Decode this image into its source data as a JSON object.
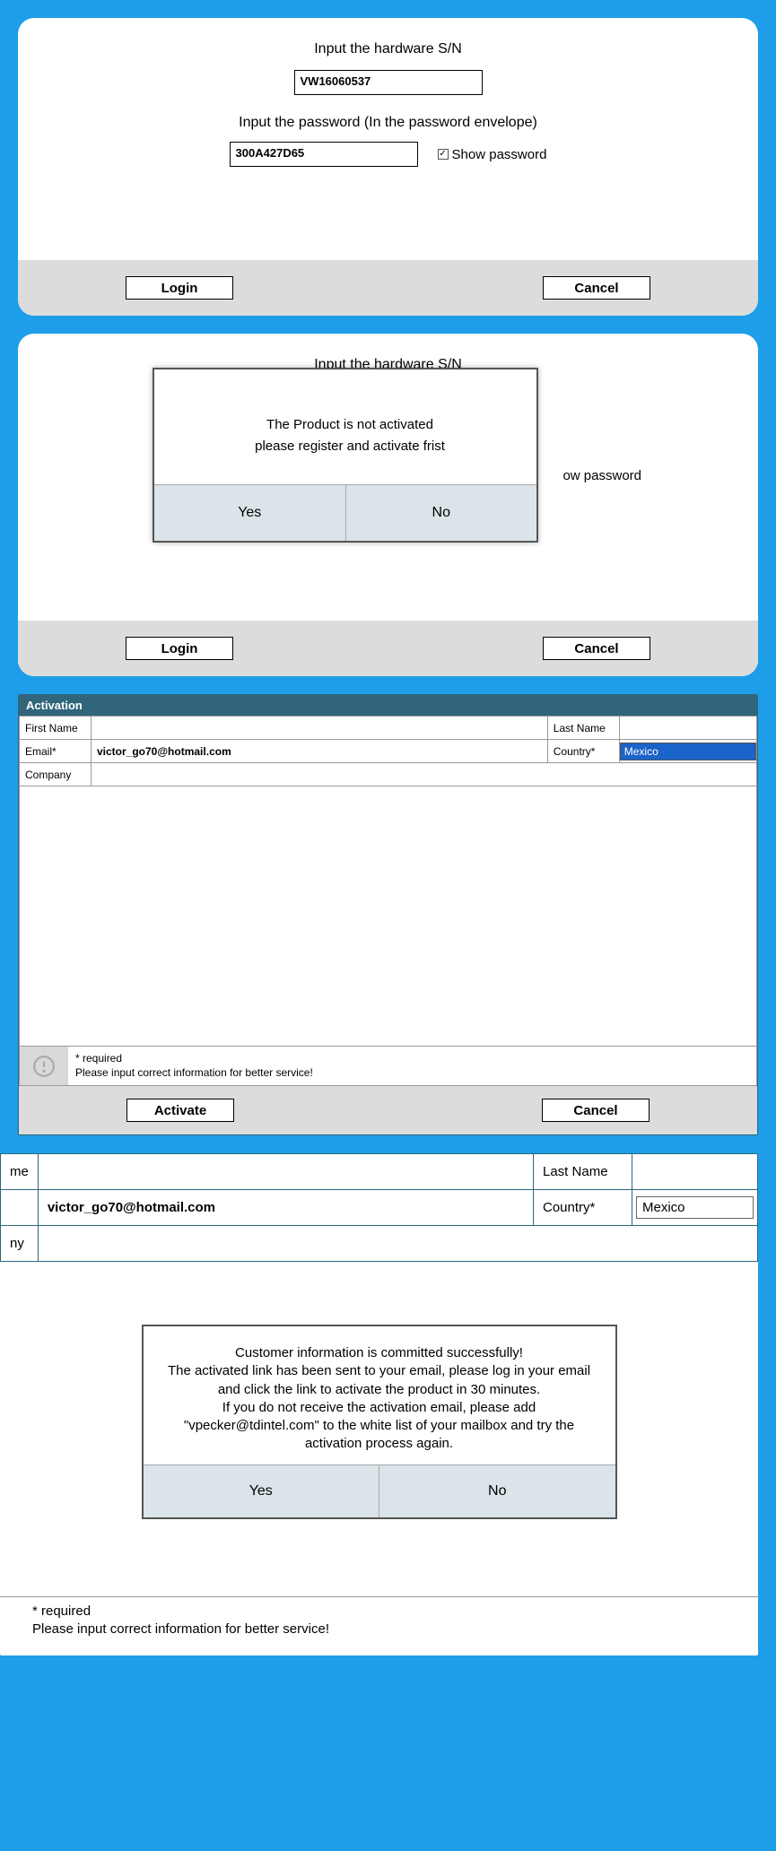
{
  "panel1": {
    "sn_label": "Input the hardware S/N",
    "sn_value": "VW16060537",
    "pwd_label": "Input the password (In the password envelope)",
    "pwd_value": "300A427D65",
    "show_password": "Show password",
    "login": "Login",
    "cancel": "Cancel"
  },
  "panel2": {
    "sn_label_partial": "Input the hardware S/N",
    "modal_line1": "The Product is not activated",
    "modal_line2": "please register and activate frist",
    "yes": "Yes",
    "no": "No",
    "show_pw_partial": "ow password",
    "login": "Login",
    "cancel": "Cancel"
  },
  "panel3": {
    "title": "Activation",
    "first_name_lbl": "First Name",
    "last_name_lbl": "Last Name",
    "email_lbl": "Email*",
    "email_val": "victor_go70@hotmail.com",
    "country_lbl": "Country*",
    "country_val": "Mexico",
    "company_lbl": "Company",
    "required": "* required",
    "required_hint": "Please input correct information for better service!",
    "activate": "Activate",
    "cancel": "Cancel"
  },
  "panel4": {
    "name_lbl_partial": "me",
    "last_name_lbl": "Last Name",
    "email_val": "victor_go70@hotmail.com",
    "country_lbl": "Country*",
    "country_val": "Mexico",
    "company_lbl_partial": "ny",
    "modal_l1": "Customer information is committed successfully!",
    "modal_l2": "The activated link has been sent to your email, please log in your email and click the link to activate the product in 30 minutes.",
    "modal_l3": "If you do not receive the activation email, please add \"vpecker@tdintel.com\" to the white list of your mailbox and try the activation process again.",
    "yes": "Yes",
    "no": "No",
    "required": "* required",
    "required_hint": "Please input correct information for better service!"
  }
}
